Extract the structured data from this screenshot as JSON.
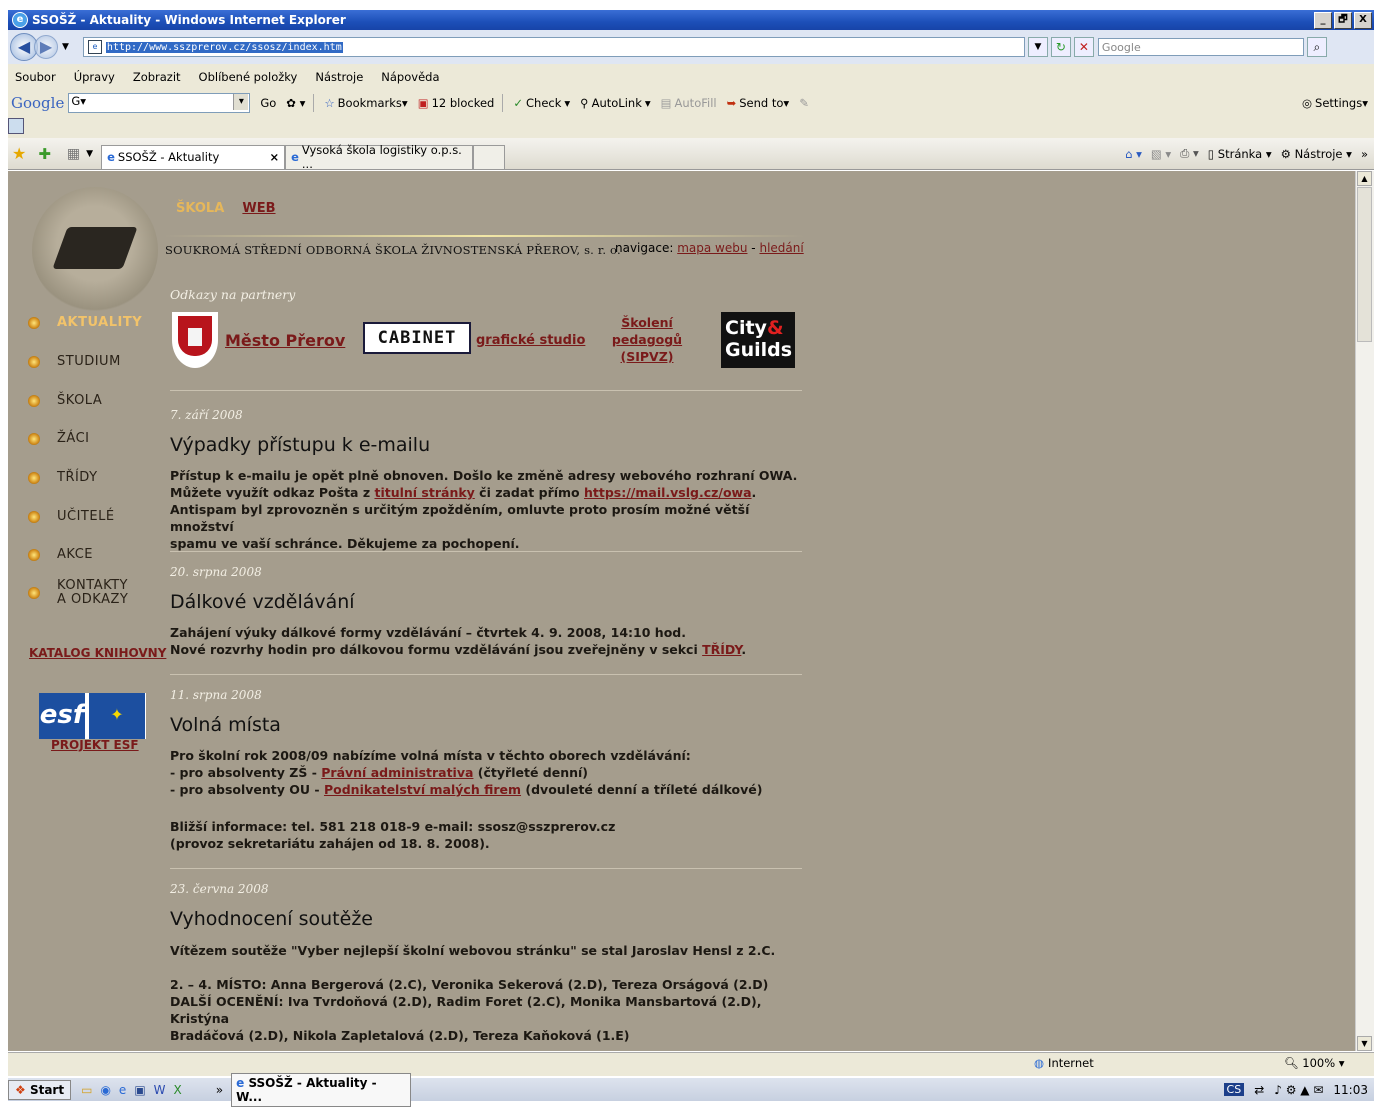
{
  "window": {
    "title": "SSOŠŽ - Aktuality - Windows Internet Explorer",
    "buttons": [
      "_",
      "🗗",
      "X"
    ]
  },
  "address": {
    "url": "http://www.sszprerov.cz/ssosz/index.htm",
    "search_placeholder": "Google"
  },
  "menu": [
    "Soubor",
    "Úpravy",
    "Zobrazit",
    "Oblíbené položky",
    "Nástroje",
    "Nápověda"
  ],
  "google_toolbar": {
    "logo": "Google",
    "input_value": "G▾",
    "go": "Go",
    "bookmarks": "Bookmarks▾",
    "blocked": "12 blocked",
    "check": "Check",
    "autolink": "AutoLink",
    "autofill": "AutoFill",
    "send_to": "Send to▾",
    "settings": "Settings▾"
  },
  "tabs": [
    {
      "label": "SSOŠŽ - Aktuality",
      "close": "×"
    },
    {
      "label": "Vysoká škola logistiky o.p.s. ..."
    }
  ],
  "commands": {
    "page": "Stránka",
    "tools": "Nástroje",
    "more": "»"
  },
  "site": {
    "top_tabs": {
      "current": "ŠKOLA",
      "other": "WEB"
    },
    "org_name": "SOUKROMÁ STŘEDNÍ ODBORNÁ ŠKOLA ŽIVNOSTENSKÁ PŘEROV, s. r. o.",
    "nav_label": "navigace:",
    "nav_links": [
      "mapa webu",
      "hledání"
    ],
    "nav_sep": "-",
    "partners_label": "Odkazy na partnery",
    "partners": {
      "mesto": "Město Přerov",
      "cabinet": "CABINET",
      "graficke": "grafické studio",
      "skoleni": [
        "Školení",
        "pedagogů",
        "(SIPVZ)"
      ],
      "city_guilds": [
        "City",
        "&",
        "Guilds"
      ]
    },
    "sidebar": [
      {
        "label": "AKTUALITY",
        "active": true
      },
      {
        "label": "STUDIUM"
      },
      {
        "label": "ŠKOLA"
      },
      {
        "label": "ŽÁCI"
      },
      {
        "label": "TŘÍDY"
      },
      {
        "label": "UČITELÉ"
      },
      {
        "label": "AKCE"
      },
      {
        "label": "KONTAKTY\nA ODKAZY"
      }
    ],
    "katalog": "KATALOG KNIHOVNY",
    "esf": {
      "logo": "esf",
      "link": "PROJEKT ESF"
    },
    "news": [
      {
        "date": "7. září 2008",
        "title": "Výpadky přístupu k e-mailu",
        "l1": "Přístup k e-mailu je opět plně obnoven. Došlo ke změně adresy webového rozhraní OWA.",
        "l2a": "Můžete využít odkaz Pošta z ",
        "l2link": "titulní stránky",
        "l2b": " či zadat přímo ",
        "l2link2": "https://mail.vslg.cz/owa",
        "l2c": ".",
        "l3": "Antispam byl zprovozněn s určitým zpožděním, omluvte proto prosím možné větší množství",
        "l4": "spamu ve vaší schránce. Děkujeme za pochopení."
      },
      {
        "date": "20. srpna 2008",
        "title": "Dálkové vzdělávání",
        "l1": "Zahájení výuky dálkové formy vzdělávání – čtvrtek 4. 9. 2008, 14:10 hod.",
        "l2a": "Nové rozvrhy hodin pro dálkovou formu vzdělávání jsou zveřejněny v sekci ",
        "l2link": "TŘÍDY",
        "l2c": "."
      },
      {
        "date": "11. srpna 2008",
        "title": "Volná místa",
        "l1": "Pro školní rok 2008/09 nabízíme volná místa v těchto oborech vzdělávání:",
        "l2a": "- pro absolventy ZŠ - ",
        "l2link": "Právní administrativa",
        "l2c": " (čtyřleté denní)",
        "l3a": "- pro absolventy OU - ",
        "l3link": "Podnikatelství malých firem",
        "l3c": " (dvouleté denní a tříleté dálkové)",
        "l4": "Bližší informace: tel. 581 218 018-9 e-mail: ssosz@sszprerov.cz",
        "l5": "(provoz sekretariátu zahájen od 18. 8. 2008)."
      },
      {
        "date": "23. června 2008",
        "title": "Vyhodnocení soutěže",
        "l1": "Vítězem soutěže \"Vyber nejlepší školní webovou stránku\" se stal Jaroslav Hensl z 2.C.",
        "l2": "2. – 4. MÍSTO: Anna Bergerová (2.C), Veronika Sekerová (2.D), Tereza Orságová (2.D)",
        "l3": "DALŠÍ OCENĚNÍ: Iva Tvrdoňová (2.D), Radim Foret (2.C), Monika Mansbartová (2.D), Kristýna",
        "l4": "Bradáčová (2.D), Nikola Zapletalová (2.D), Tereza Kaňoková (1.E)"
      }
    ]
  },
  "status": {
    "zone": "Internet",
    "zoom": "100%"
  },
  "taskbar": {
    "start": "Start",
    "chevron": "»",
    "window": "SSOŠŽ - Aktuality - W...",
    "lang": "CS",
    "time": "11:03"
  }
}
